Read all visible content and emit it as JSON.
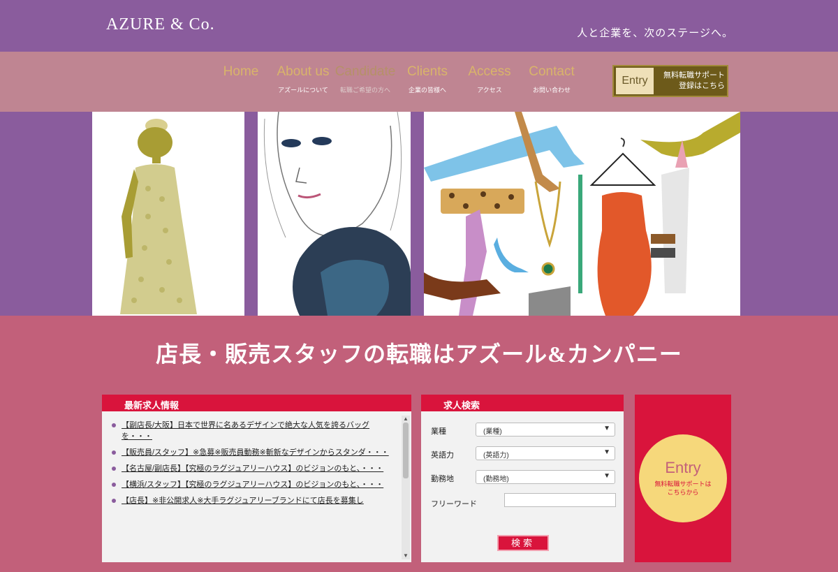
{
  "header": {
    "logo": "AZURE & Co.",
    "tagline": "人と企業を、次のステージへ。"
  },
  "nav": {
    "items": [
      {
        "en": "Home",
        "jp": ""
      },
      {
        "en": "About us",
        "jp": "アズールについて"
      },
      {
        "en": "Candidate",
        "jp": "転職ご希望の方へ"
      },
      {
        "en": "Clients",
        "jp": "企業の皆様へ"
      },
      {
        "en": "Access",
        "jp": "アクセス"
      },
      {
        "en": "Contact",
        "jp": "お問い合わせ"
      }
    ],
    "entry": {
      "label": "Entry",
      "line1": "無料転職サポート",
      "line2": "登録はこちら"
    }
  },
  "headline": "店長・販売スタッフの転職はアズール&カンパニー",
  "jobs": {
    "title": "最新求人情報",
    "items": [
      "【副店長/大阪】日本で世界に名あるデザインで絶大な人気を誇るバッグを・・・",
      "【販売員/スタッフ】※急募※販売員動務※斬新なデザインからスタンダ・・・",
      "【名古屋/副店長】【究極のラグジュアリーハウス】のビジョンのもと、・・・",
      "【横浜/スタッフ】【究極のラグジュアリーハウス】のビジョンのもと、・・・",
      "【店長】※非公開求人※大手ラグジュアリーブランドにて店長を募集し"
    ]
  },
  "search": {
    "title": "求人検索",
    "fields": [
      {
        "label": "業種",
        "value": "(業種)"
      },
      {
        "label": "英語力",
        "value": "(英語力)"
      },
      {
        "label": "勤務地",
        "value": "(勤務地)"
      }
    ],
    "freeword_label": "フリーワード",
    "button": "検索"
  },
  "entrybox": {
    "big": "Entry",
    "small1": "無料転職サポートは",
    "small2": "こちらから"
  },
  "colors": {
    "purple": "#8a5c9d",
    "rose": "#c2607a",
    "red": "#d9143c",
    "gold": "#d9b46a"
  }
}
